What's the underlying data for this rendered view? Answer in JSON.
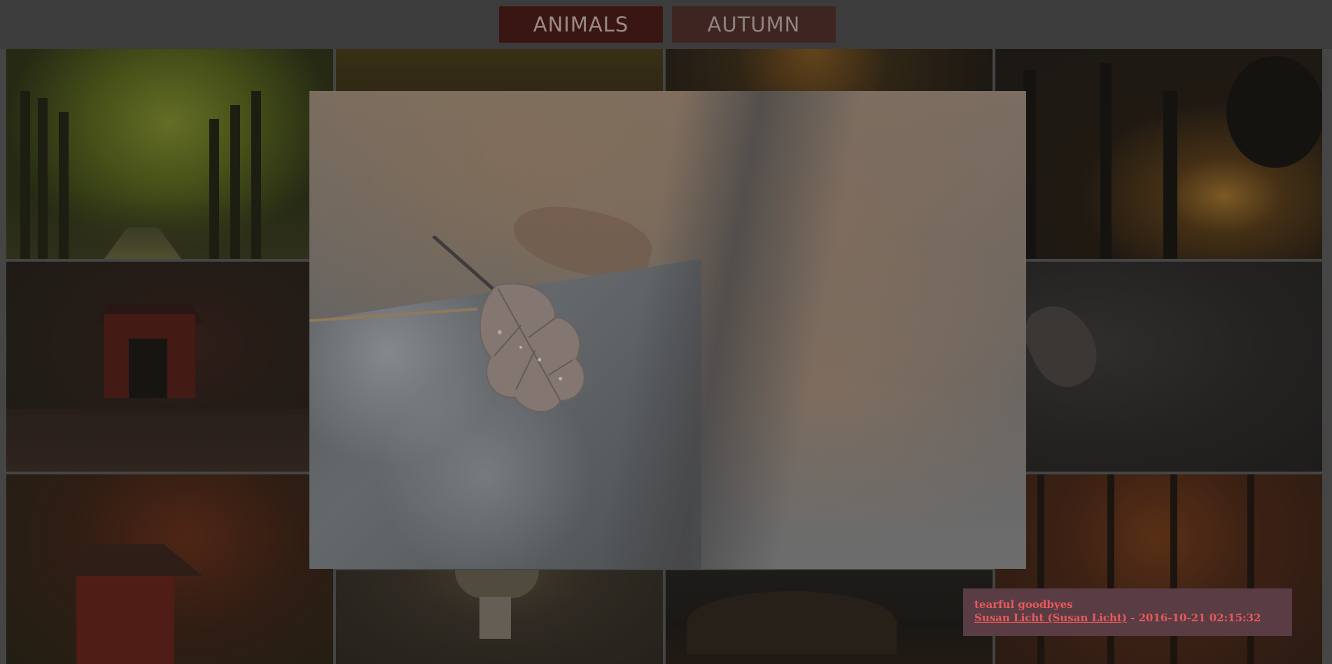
{
  "nav": {
    "tabs": [
      {
        "label": "ANIMALS",
        "active": true
      },
      {
        "label": "AUTUMN",
        "active": false
      }
    ]
  },
  "gallery": {
    "tiles": [
      {
        "subject": "tree avenue"
      },
      {
        "subject": "forest"
      },
      {
        "subject": "forest sunset"
      },
      {
        "subject": "sun through trees"
      },
      {
        "subject": "covered bridge"
      },
      {
        "subject": "wet leaf"
      },
      {
        "subject": "pagoda"
      },
      {
        "subject": "mushroom"
      },
      {
        "subject": "field"
      },
      {
        "subject": "orange forest"
      }
    ]
  },
  "lightbox": {
    "caption": {
      "title": "tearful goodbyes",
      "author": "Susan Licht (Susan Licht)",
      "separator": " - ",
      "date": "2016-10-21 02:15:32"
    }
  },
  "colors": {
    "caption_text": "#e85a5a",
    "caption_bg": "#5a3c44",
    "active_tab_bg": "#3a1612"
  }
}
